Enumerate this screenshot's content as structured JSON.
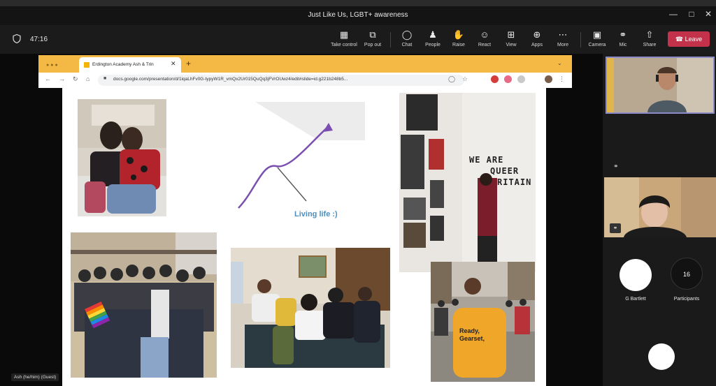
{
  "window": {
    "title": "Just Like Us, LGBT+ awareness"
  },
  "meeting": {
    "timer": "47:16"
  },
  "toolbar": {
    "buttons": [
      {
        "label": "Take control",
        "icon": "take-control-icon"
      },
      {
        "label": "Pop out",
        "icon": "pop-out-icon"
      },
      {
        "label": "Chat",
        "icon": "chat-icon"
      },
      {
        "label": "People",
        "icon": "people-icon"
      },
      {
        "label": "Raise",
        "icon": "raise-hand-icon"
      },
      {
        "label": "React",
        "icon": "react-icon"
      },
      {
        "label": "View",
        "icon": "view-icon"
      },
      {
        "label": "Apps",
        "icon": "apps-icon"
      },
      {
        "label": "More",
        "icon": "more-icon"
      },
      {
        "label": "Camera",
        "icon": "camera-icon"
      },
      {
        "label": "Mic",
        "icon": "mic-icon"
      },
      {
        "label": "Share",
        "icon": "share-icon"
      }
    ],
    "leave_label": "Leave"
  },
  "browser": {
    "tab_title": "Erdington Academy Ash & Trin",
    "url": "docs.google.com/presentation/d/1iqaLhFv0G-typyW1R_vmQx2Ur015QuQq3jFVrOUwz4/edit#slide=id.g221b248b5..."
  },
  "slide": {
    "caption": "Living life :)",
    "wall_text": [
      "WE ARE",
      "QUEER",
      "RITAIN"
    ],
    "shirt_text": [
      "Ready,",
      "Gearset,"
    ]
  },
  "participants": {
    "tile_name": "G Bartlett",
    "count": "16",
    "count_label": "Participants"
  },
  "presenter": {
    "name_tag": "Ash (he/him) (Guest)"
  },
  "colors": {
    "accent": "#8b8cc7",
    "leave": "#c4314b",
    "browser_chrome": "#f4b945",
    "arrow": "#7b4fb0"
  }
}
